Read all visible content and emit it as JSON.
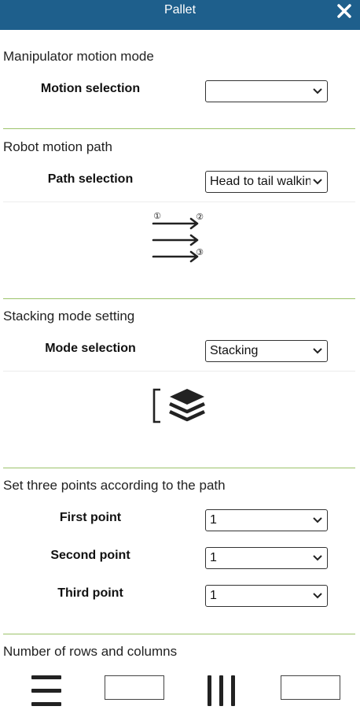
{
  "window": {
    "title": "Pallet",
    "close_icon": "close-icon"
  },
  "sections": {
    "manipulator": {
      "title": "Manipulator motion mode",
      "label": "Motion selection",
      "value": ""
    },
    "path": {
      "title": "Robot motion path",
      "label": "Path selection",
      "value": "Head to tail walking",
      "markers": [
        "①",
        "②",
        "③"
      ],
      "icon": "path-arrows-icon"
    },
    "stacking": {
      "title": "Stacking mode setting",
      "label": "Mode selection",
      "value": "Stacking",
      "icon": "stacking-layers-icon"
    },
    "points": {
      "title": "Set three points according to the path",
      "first_label": "First point",
      "first_value": "1",
      "second_label": "Second point",
      "second_value": "1",
      "third_label": "Third point",
      "third_value": "1"
    },
    "rows_cols": {
      "title": "Number of rows and columns",
      "rows_icon": "rows-icon",
      "columns_icon": "columns-icon",
      "rows_value": "",
      "columns_value": ""
    }
  },
  "colors": {
    "titlebar": "#1e5f8c",
    "divider": "#9cc36a"
  }
}
